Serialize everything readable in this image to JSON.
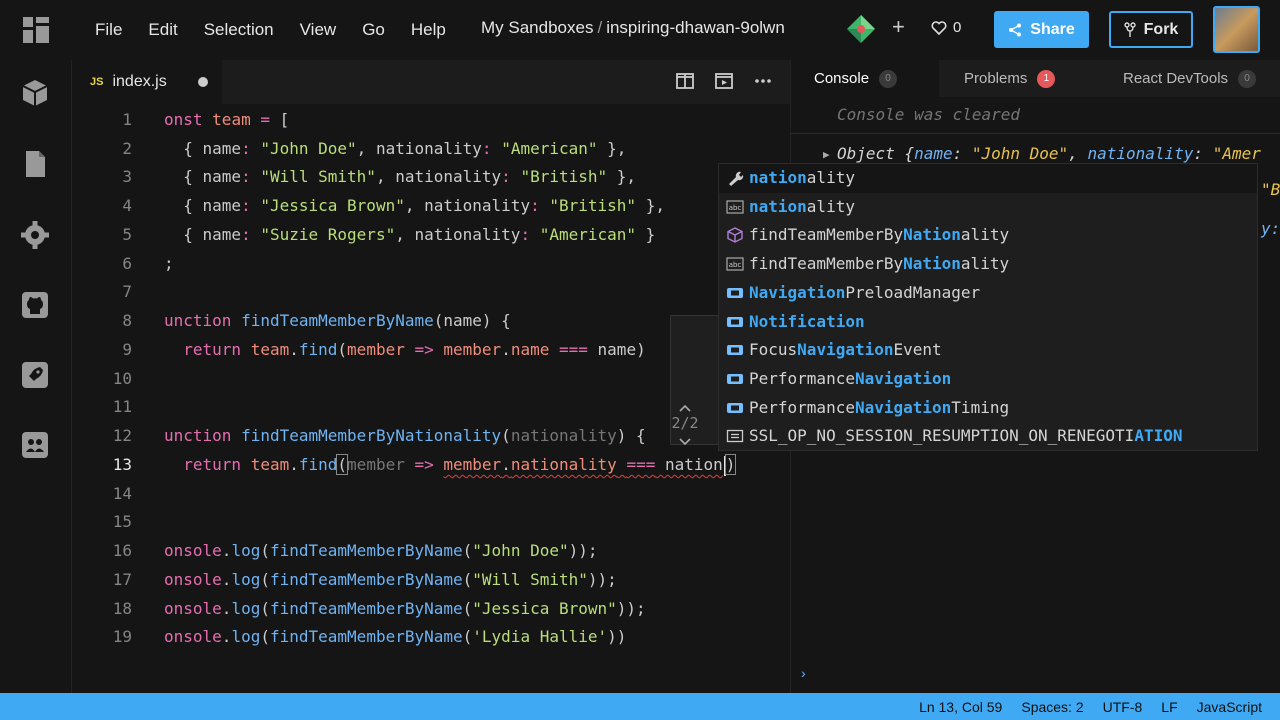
{
  "menu": [
    "File",
    "Edit",
    "Selection",
    "View",
    "Go",
    "Help"
  ],
  "breadcrumb": {
    "parent": "My Sandboxes",
    "separator": "/",
    "sandbox": "inspiring-dhawan-9olwn"
  },
  "likes": "0",
  "share_label": "Share",
  "fork_label": "Fork",
  "editor": {
    "tab": {
      "badge": "JS",
      "name": "index.js"
    },
    "line_numbers": [
      "1",
      "2",
      "3",
      "4",
      "5",
      "6",
      "7",
      "8",
      "9",
      "10",
      "11",
      "12",
      "13",
      "14",
      "15",
      "16",
      "17",
      "18",
      "19"
    ],
    "param_hint_count": "2/2"
  },
  "suggestions": [
    {
      "icon": "wrench-icon",
      "pre": "",
      "hl": "nation",
      "post": "ality"
    },
    {
      "icon": "text-abc-icon",
      "pre": "",
      "hl": "nation",
      "post": "ality"
    },
    {
      "icon": "cube-icon",
      "pre": "findTeamMemberBy",
      "hl": "Nation",
      "post": "ality"
    },
    {
      "icon": "text-abc-icon",
      "pre": "findTeamMemberBy",
      "hl": "Nation",
      "post": "ality"
    },
    {
      "icon": "class-icon",
      "pre": "",
      "hl": "Navigation",
      "post": "PreloadManager"
    },
    {
      "icon": "class-icon",
      "pre": "",
      "hl": "Notification",
      "post": ""
    },
    {
      "icon": "class-icon",
      "pre": "Focus",
      "hl": "Navigation",
      "post": "Event"
    },
    {
      "icon": "class-icon",
      "pre": "Performance",
      "hl": "Navigation",
      "post": ""
    },
    {
      "icon": "class-icon",
      "pre": "Performance",
      "hl": "Navigation",
      "post": "Timing"
    },
    {
      "icon": "constant-icon",
      "pre": "SSL_OP_NO_SESSION_RESUMPTION_ON_RENEGOTI",
      "hl": "ATION",
      "post": ""
    }
  ],
  "panel": {
    "tabs": [
      {
        "label": "Console",
        "count": "0"
      },
      {
        "label": "Problems",
        "count": "1"
      },
      {
        "label": "React DevTools",
        "count": "0"
      }
    ],
    "cleared": "Console was cleared"
  },
  "status": {
    "position": "Ln 13, Col 59",
    "spaces": "Spaces: 2",
    "encoding": "UTF-8",
    "eol": "LF",
    "language": "JavaScript"
  },
  "colors": {
    "accent": "#40a9f3",
    "error": "#e5595b",
    "background": "#151515"
  }
}
